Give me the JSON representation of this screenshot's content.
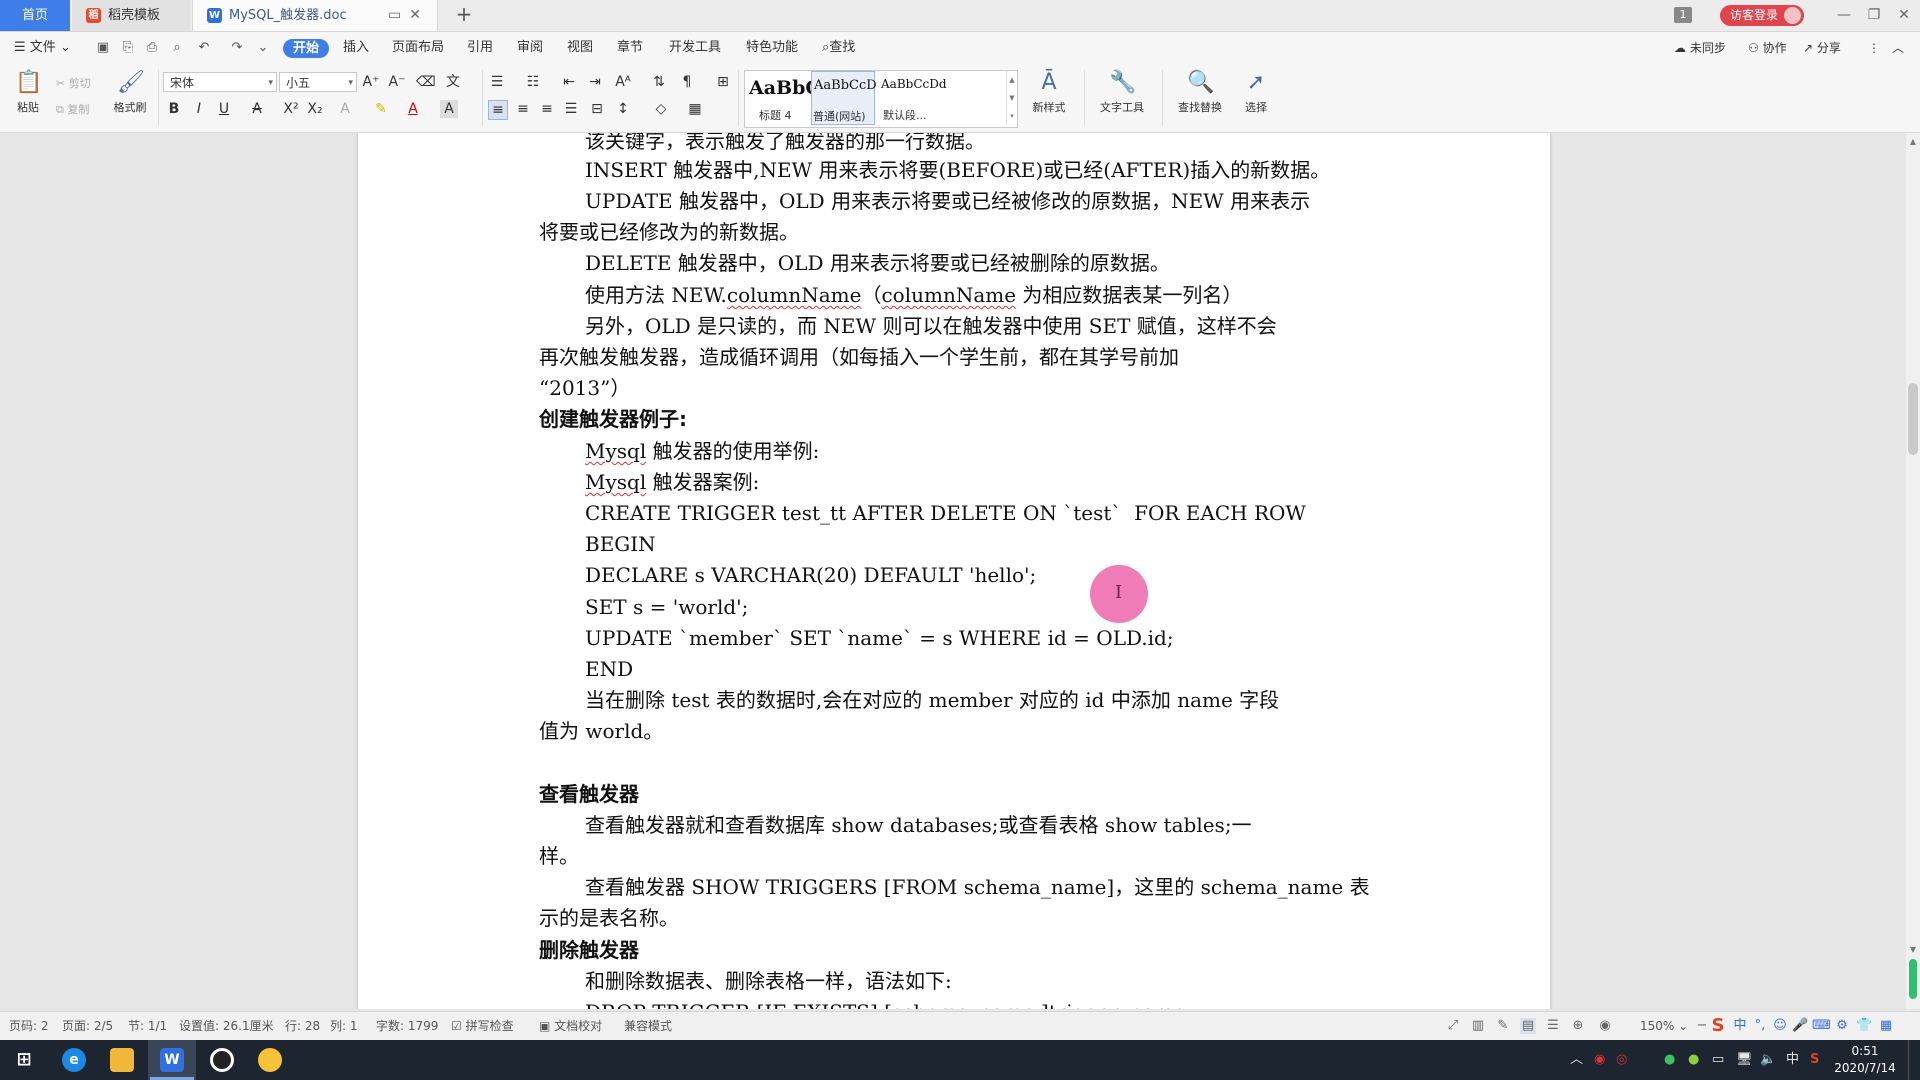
{
  "tabs": {
    "home": "首页",
    "daoke": "稻壳模板",
    "doc": "MySQL_触发器.doc",
    "doc_icon": "W"
  },
  "titlebar": {
    "notice_count": "1",
    "login": "访客登录"
  },
  "menu": {
    "file": "文件",
    "items": [
      "开始",
      "插入",
      "页面布局",
      "引用",
      "审阅",
      "视图",
      "章节",
      "开发工具",
      "特色功能"
    ],
    "search": "查找",
    "unsynced": "未同步",
    "collab": "协作",
    "share": "分享"
  },
  "ribbon": {
    "paste": "粘贴",
    "cut": "剪切",
    "copy": "复制",
    "format_painter": "格式刷",
    "font_name": "宋体",
    "font_size": "小五",
    "styles": [
      {
        "sample": "AaBbC",
        "name": "标题 4"
      },
      {
        "sample": "AaBbCcD",
        "name": "普通(网站)"
      },
      {
        "sample": "AaBbCcDd",
        "name": "默认段..."
      }
    ],
    "new_style": "新样式",
    "text_tools": "文字工具",
    "find_replace": "查找替换",
    "select": "选择"
  },
  "document": {
    "lines": [
      "该关键字，表示触发了触发器的那一行数据。",
      "INSERT 触发器中,NEW 用来表示将要(BEFORE)或已经(AFTER)插入的新数据。",
      "UPDATE 触发器中，OLD 用来表示将要或已经被修改的原数据，NEW 用来表示",
      "将要或已经修改为的新数据。",
      "DELETE 触发器中，OLD 用来表示将要或已经被删除的原数据。",
      "使用方法 NEW.",
      "columnName",
      "（",
      "columnName",
      " 为相应数据表某一列名）",
      "另外，OLD 是只读的，而 NEW 则可以在触发器中使用 SET 赋值，这样不会",
      "再次触发触发器，造成循环调用（如每插入一个学生前，都在其学号前加",
      "“2013”）",
      "创建触发器例子:",
      "Mysql",
      " 触发器的使用举例:",
      "Mysql",
      " 触发器案例:",
      "CREATE TRIGGER test_tt AFTER DELETE ON `test`  FOR EACH ROW",
      "BEGIN",
      "DECLARE s VARCHAR(20) DEFAULT 'hello';",
      "SET s = 'world';",
      "UPDATE `member` SET `name` = s WHERE id = OLD.id;",
      "END",
      "当在删除 test 表的数据时,会在对应的 member 对应的 id 中添加 name 字段",
      "值为 world。",
      "查看触发器",
      "查看触发器就和查看数据库 show databases;或查看表格 show tables;一",
      "样。",
      "查看触发器 SHOW TRIGGERS [FROM schema_name]，这里的 schema_name 表",
      "示的是表名称。",
      "删除触发器",
      "和删除数据表、删除表格一样，语法如下:",
      "DROP TRIGGER [IF EXISTS] [schema_name.]trigger_name;"
    ]
  },
  "status": {
    "page_code": "页码: 2",
    "page": "页面: 2/5",
    "section": "节: 1/1",
    "setting": "设置值: 26.1厘米",
    "row": "行: 28",
    "col": "列: 1",
    "words": "字数: 1799",
    "spell_check": "拼写检查",
    "doc_proof": "文档校对",
    "compat": "兼容模式",
    "zoom": "150%"
  },
  "taskbar": {
    "time": "0:51",
    "date": "2020/7/14",
    "ime": "中"
  },
  "colors": {
    "accent": "#3f7ee8",
    "login": "#e0454f",
    "cursor_dot": "#ec64aa"
  }
}
